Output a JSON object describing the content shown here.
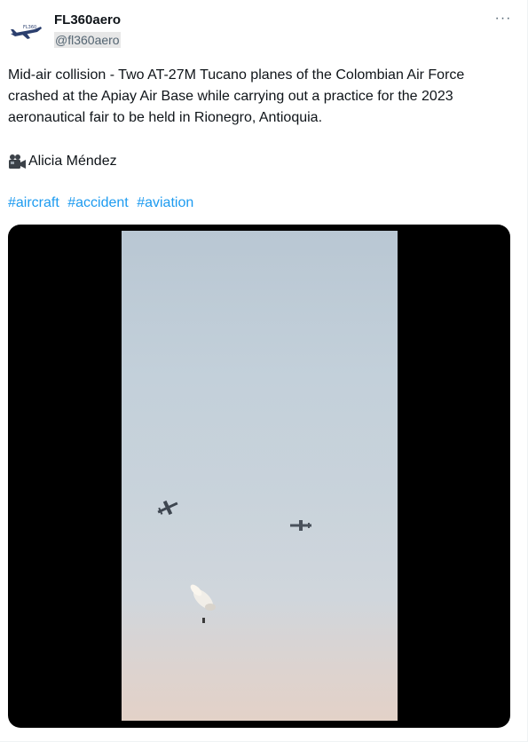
{
  "author": {
    "display_name": "FL360aero",
    "handle": "@fl360aero",
    "avatar_text": "FL360"
  },
  "tweet": {
    "text": "Mid-air collision - Two AT-27M Tucano planes of the Colombian Air Force crashed at the Apiay Air Base while carrying out a practice for the 2023 aeronautical fair to be held in Rionegro, Antioquia.",
    "credit": "Alicia Méndez",
    "credit_icon": "video-camera-icon",
    "hashtags": [
      "#aircraft",
      "#accident",
      "#aviation"
    ]
  },
  "menu": {
    "more_label": "···"
  },
  "colors": {
    "link": "#1d9bf0",
    "text": "#0f1419",
    "secondary": "#536471",
    "media_bg": "#000000"
  }
}
